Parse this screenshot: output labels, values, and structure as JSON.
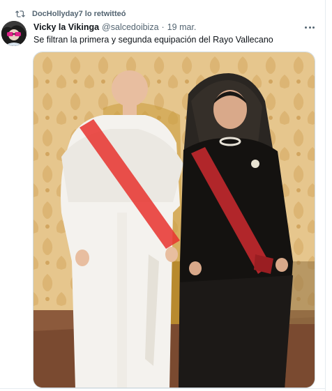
{
  "retweet": {
    "text": "DocHollyday7 lo retwitteó",
    "icon": "retweet-icon"
  },
  "tweet": {
    "display_name": "Vicky la Vikinga",
    "handle": "@salcedoibiza",
    "separator": "·",
    "time": "19 mar.",
    "text": "Se filtran la primera y segunda equipación del Rayo Vallecano",
    "more_icon": "more-options-icon"
  },
  "media": {
    "alt": "photo"
  },
  "colors": {
    "secondary_text": "#536471",
    "border": "#cfd9de",
    "stripe": "#e8322e",
    "sash": "#b1262a"
  }
}
